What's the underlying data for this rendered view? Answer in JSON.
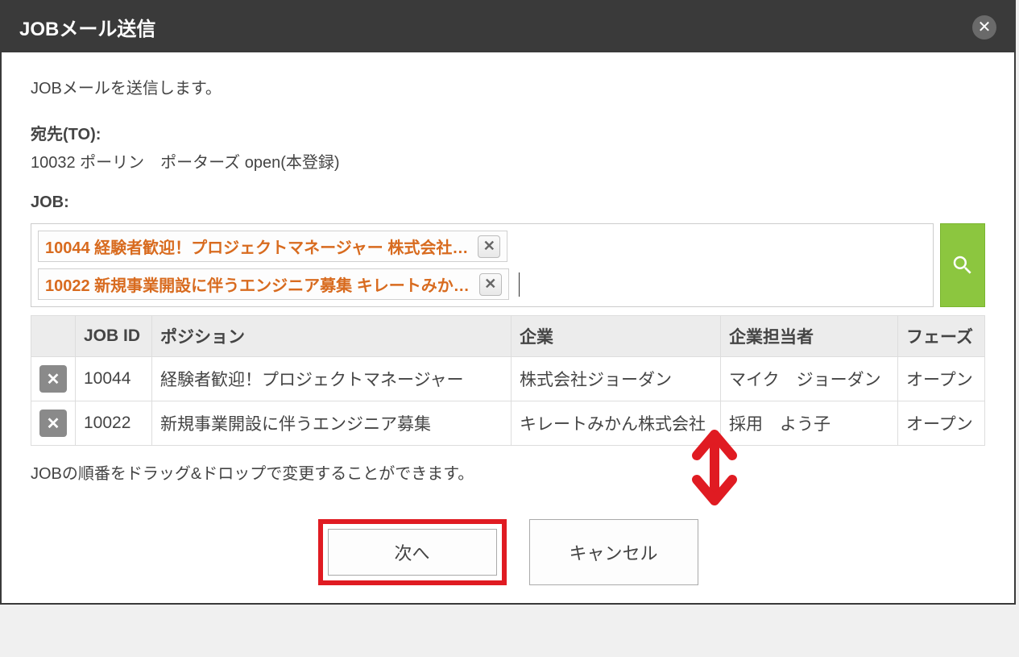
{
  "header": {
    "title": "JOBメール送信"
  },
  "intro": "JOBメールを送信します。",
  "to": {
    "label": "宛先(TO):",
    "value": "10032 ポーリン　ポーターズ open(本登録)"
  },
  "job": {
    "label": "JOB:",
    "tags": [
      "10044 経験者歓迎！プロジェクトマネージャー 株式会社…",
      "10022 新規事業開設に伴うエンジニア募集 キレートみか…"
    ]
  },
  "table": {
    "headers": {
      "remove": "",
      "id": "JOB ID",
      "position": "ポジション",
      "company": "企業",
      "contact": "企業担当者",
      "phase": "フェーズ"
    },
    "rows": [
      {
        "id": "10044",
        "position": "経験者歓迎！プロジェクトマネージャー",
        "company": "株式会社ジョーダン",
        "contact": "マイク　ジョーダン",
        "phase": "オープン"
      },
      {
        "id": "10022",
        "position": "新規事業開設に伴うエンジニア募集",
        "company": "キレートみかん株式会社",
        "contact": "採用　よう子",
        "phase": "オープン"
      }
    ]
  },
  "hint": "JOBの順番をドラッグ&ドロップで変更することができます。",
  "buttons": {
    "next": "次へ",
    "cancel": "キャンセル"
  }
}
